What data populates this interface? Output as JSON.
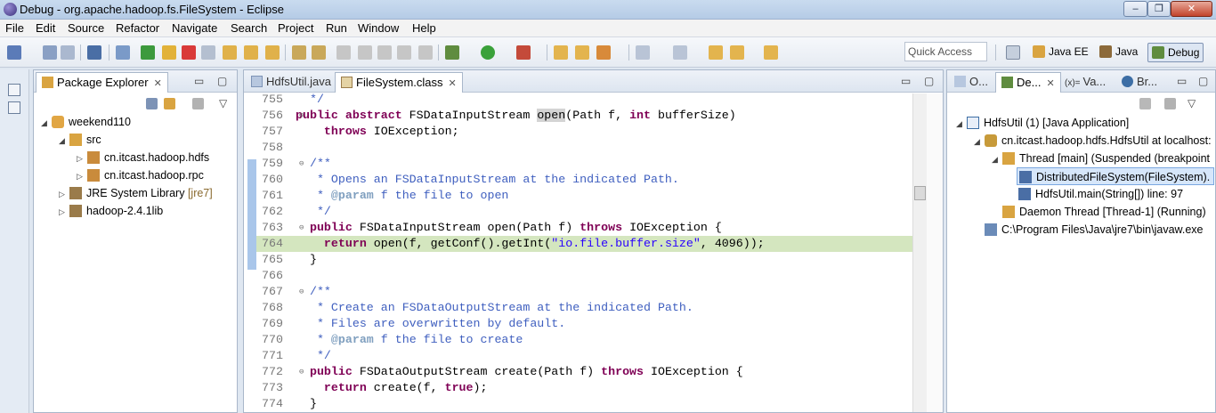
{
  "window": {
    "title": "Debug - org.apache.hadoop.fs.FileSystem - Eclipse",
    "min": "–",
    "max": "❐",
    "close": "✕"
  },
  "menu": [
    "File",
    "Edit",
    "Source",
    "Refactor",
    "Navigate",
    "Search",
    "Project",
    "Run",
    "Window",
    "Help"
  ],
  "toolbar": {
    "quick_access_placeholder": "Quick Access"
  },
  "perspectives": {
    "java_ee": "Java EE",
    "java": "Java",
    "debug": "Debug"
  },
  "package_explorer": {
    "tab_label": "Package Explorer",
    "items": [
      {
        "label": "weekend110",
        "decor": ""
      },
      {
        "label": "src",
        "decor": ""
      },
      {
        "label": "cn.itcast.hadoop.hdfs",
        "decor": ""
      },
      {
        "label": "cn.itcast.hadoop.rpc",
        "decor": ""
      },
      {
        "label": "JRE System Library",
        "decor": "[jre7]"
      },
      {
        "label": "hadoop-2.4.1lib",
        "decor": ""
      }
    ]
  },
  "editor": {
    "tabs": [
      {
        "label": "HdfsUtil.java"
      },
      {
        "label": "FileSystem.class"
      }
    ],
    "lines": [
      {
        "n": "755",
        "f": "",
        "cur": false,
        "s": [
          [
            "cm",
            "  */"
          ]
        ]
      },
      {
        "n": "756",
        "f": "⊖",
        "cur": false,
        "s": [
          [
            "kw",
            "public abstract"
          ],
          [
            "",
            " FSDataInputStream "
          ],
          [
            "occ",
            "open"
          ],
          [
            "",
            "(Path f, "
          ],
          [
            "kw",
            "int"
          ],
          [
            "",
            " bufferSize)"
          ]
        ]
      },
      {
        "n": "757",
        "f": "",
        "cur": false,
        "s": [
          [
            "",
            "    "
          ],
          [
            "kw",
            "throws"
          ],
          [
            "",
            " IOException;"
          ]
        ]
      },
      {
        "n": "758",
        "f": "",
        "cur": false,
        "s": []
      },
      {
        "n": "759",
        "f": "⊖",
        "cur": false,
        "s": [
          [
            "cm",
            "  /**"
          ]
        ]
      },
      {
        "n": "760",
        "f": "",
        "cur": false,
        "s": [
          [
            "cm",
            "   * Opens an FSDataInputStream at the indicated Path."
          ]
        ]
      },
      {
        "n": "761",
        "f": "",
        "cur": false,
        "s": [
          [
            "cm",
            "   * "
          ],
          [
            "tg",
            "@param"
          ],
          [
            "cm",
            " f the file to open"
          ]
        ]
      },
      {
        "n": "762",
        "f": "",
        "cur": false,
        "s": [
          [
            "cm",
            "   */"
          ]
        ]
      },
      {
        "n": "763",
        "f": "⊖",
        "cur": false,
        "s": [
          [
            "",
            "  "
          ],
          [
            "kw",
            "public"
          ],
          [
            "",
            " FSDataInputStream open(Path f) "
          ],
          [
            "kw",
            "throws"
          ],
          [
            "",
            " IOException {"
          ]
        ]
      },
      {
        "n": "764",
        "f": "",
        "cur": true,
        "s": [
          [
            "",
            "    "
          ],
          [
            "kw",
            "return"
          ],
          [
            "",
            " open(f, getConf().getInt("
          ],
          [
            "st",
            "\"io.file.buffer.size\""
          ],
          [
            "",
            ", 4096));"
          ]
        ]
      },
      {
        "n": "765",
        "f": "",
        "cur": false,
        "s": [
          [
            "",
            "  }"
          ]
        ]
      },
      {
        "n": "766",
        "f": "",
        "cur": false,
        "s": []
      },
      {
        "n": "767",
        "f": "⊖",
        "cur": false,
        "s": [
          [
            "cm",
            "  /**"
          ]
        ]
      },
      {
        "n": "768",
        "f": "",
        "cur": false,
        "s": [
          [
            "cm",
            "   * Create an FSDataOutputStream at the indicated Path."
          ]
        ]
      },
      {
        "n": "769",
        "f": "",
        "cur": false,
        "s": [
          [
            "cm",
            "   * Files are overwritten by default."
          ]
        ]
      },
      {
        "n": "770",
        "f": "",
        "cur": false,
        "s": [
          [
            "cm",
            "   * "
          ],
          [
            "tg",
            "@param"
          ],
          [
            "cm",
            " f the file to create"
          ]
        ]
      },
      {
        "n": "771",
        "f": "",
        "cur": false,
        "s": [
          [
            "cm",
            "   */"
          ]
        ]
      },
      {
        "n": "772",
        "f": "⊖",
        "cur": false,
        "s": [
          [
            "",
            "  "
          ],
          [
            "kw",
            "public"
          ],
          [
            "",
            " FSDataOutputStream create(Path f) "
          ],
          [
            "kw",
            "throws"
          ],
          [
            "",
            " IOException {"
          ]
        ]
      },
      {
        "n": "773",
        "f": "",
        "cur": false,
        "s": [
          [
            "",
            "    "
          ],
          [
            "kw",
            "return"
          ],
          [
            "",
            " create(f, "
          ],
          [
            "kw",
            "true"
          ],
          [
            "",
            ");"
          ]
        ]
      },
      {
        "n": "774",
        "f": "",
        "cur": false,
        "s": [
          [
            "",
            "  }"
          ]
        ]
      }
    ]
  },
  "debug_view": {
    "tabs": [
      {
        "label": "O..."
      },
      {
        "label": "De..."
      },
      {
        "label": "Va..."
      },
      {
        "label": "Br..."
      }
    ],
    "var_prefix": "(x)=",
    "items": [
      {
        "label": "HdfsUtil (1) [Java Application]"
      },
      {
        "label": "cn.itcast.hadoop.hdfs.HdfsUtil at localhost:"
      },
      {
        "label": "Thread [main] (Suspended (breakpoint"
      },
      {
        "label": "DistributedFileSystem(FileSystem)."
      },
      {
        "label": "HdfsUtil.main(String[]) line: 97"
      },
      {
        "label": "Daemon Thread [Thread-1] (Running)"
      },
      {
        "label": "C:\\Program Files\\Java\\jre7\\bin\\javaw.exe"
      }
    ]
  }
}
